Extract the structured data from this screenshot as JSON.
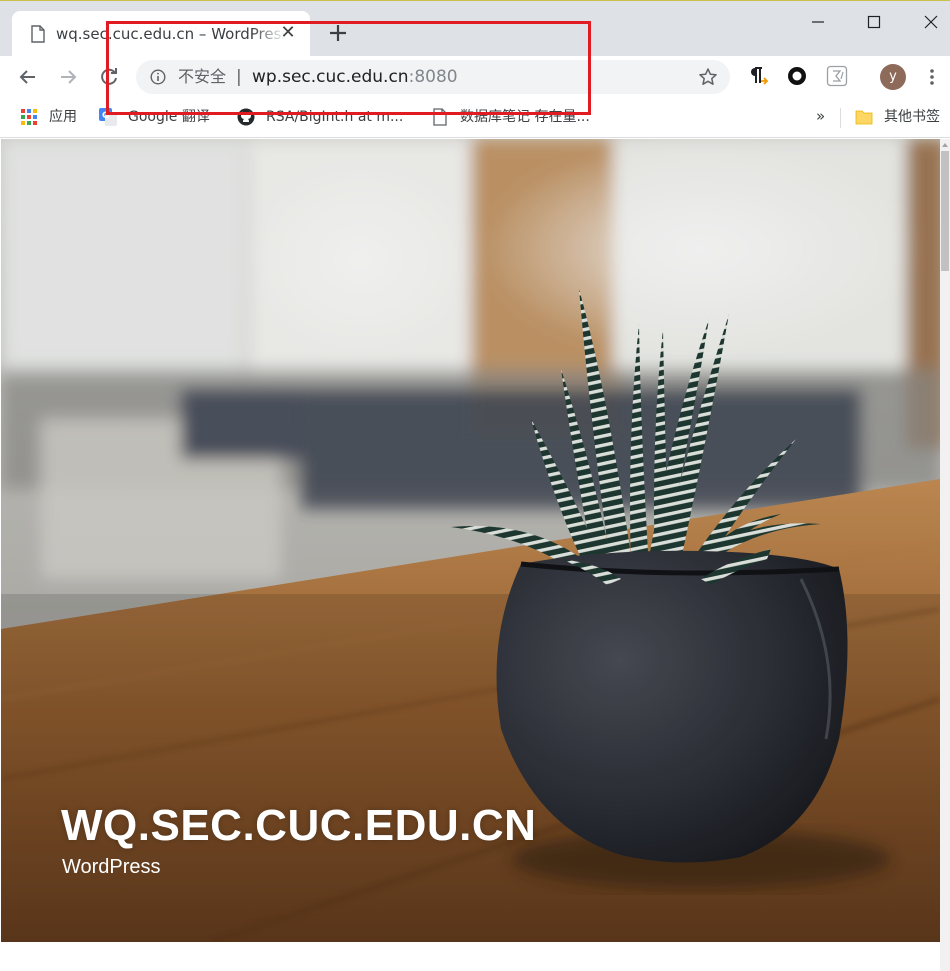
{
  "browser": {
    "tab": {
      "title": "wq.sec.cuc.edu.cn – WordPress",
      "close_glyph": "✕"
    },
    "window_controls": [
      "minimize",
      "maximize",
      "close"
    ],
    "address_bar": {
      "security_label": "不安全",
      "separator": "|",
      "url_host": "wp.sec.cuc.edu.cn",
      "url_port": ":8080"
    },
    "toolbar_icons": [
      "back-icon",
      "forward-icon",
      "reload-icon",
      "info-icon",
      "star-icon",
      "pilcrow-extension-icon",
      "circle-extension-icon",
      "sigma-extension-icon",
      "menu-icon"
    ],
    "profile_initial": "y",
    "bookmarks": [
      {
        "label": "应用",
        "icon": "apps-grid-icon"
      },
      {
        "label": "Google 翻译",
        "icon": "google-translate-icon"
      },
      {
        "label": "RSA/BigInt.h at m...",
        "icon": "github-icon"
      },
      {
        "label": "数据库笔记 存在量...",
        "icon": "page-icon"
      }
    ],
    "bookmarks_overflow": "»",
    "other_bookmarks": {
      "label": "其他书签",
      "icon": "folder-icon"
    }
  },
  "annotation": {
    "color": "#e11b22",
    "target": "address-bar"
  },
  "page": {
    "site_title": "WQ.SEC.CUC.EDU.CN",
    "site_tagline": "WordPress",
    "hero_image": "succulent-plant-in-dark-pot-on-wooden-table"
  },
  "colors": {
    "tabstrip": "#dee1e6",
    "omnibox": "#f1f3f4",
    "avatar": "#8d6a5a"
  }
}
